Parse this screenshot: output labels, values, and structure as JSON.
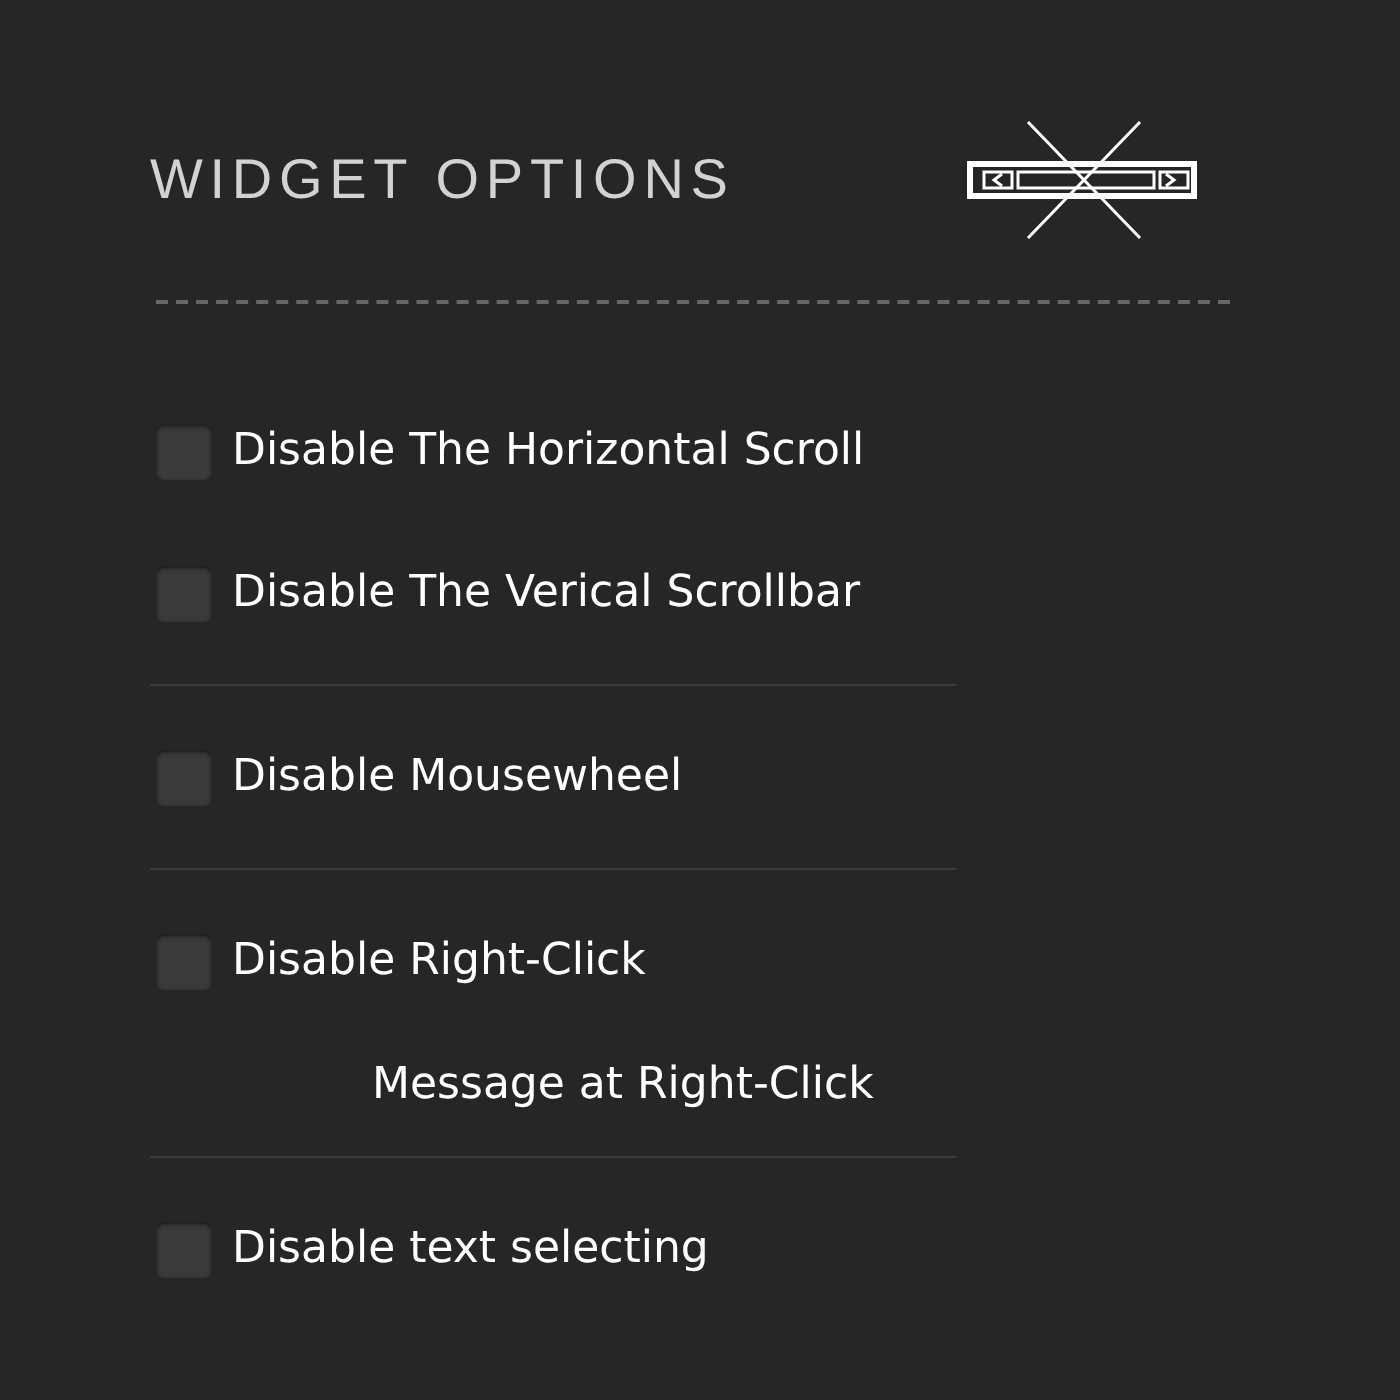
{
  "title": "WIDGET OPTIONS",
  "groups": [
    {
      "options": [
        {
          "kind": "checkbox",
          "label": "Disable The Horizontal Scroll",
          "checked": false
        },
        {
          "kind": "checkbox",
          "label": "Disable The Verical Scrollbar",
          "checked": false
        }
      ]
    },
    {
      "options": [
        {
          "kind": "checkbox",
          "label": "Disable Mousewheel",
          "checked": false
        }
      ]
    },
    {
      "options": [
        {
          "kind": "checkbox",
          "label": "Disable Right-Click",
          "checked": false
        },
        {
          "kind": "text",
          "label": "Message at Right-Click"
        }
      ]
    },
    {
      "options": [
        {
          "kind": "checkbox",
          "label": "Disable text selecting",
          "checked": false
        }
      ]
    }
  ]
}
